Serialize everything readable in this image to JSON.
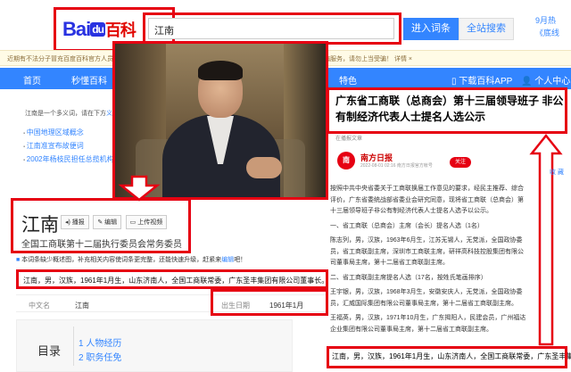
{
  "header": {
    "logo_brand": "Bai",
    "logo_du": "du",
    "logo_baike": "百科",
    "search_value": "江南",
    "enter_button": "进入词条",
    "search_button": "全站搜索",
    "top_right_1": "9月热",
    "top_right_2": "《底线"
  },
  "notice": "近期有不法分子冒充百度百科官方人员……",
  "notice_right": "不存在收费代编服务，请勿上当受骗！ 详情 ×",
  "nav": {
    "home": "首页",
    "miao": "秒懂百科",
    "tese": "特色",
    "app": "下载百科APP",
    "user": "个人中心"
  },
  "left": {
    "breadcrumb_prefix": "江南是一个多义词，请在下方",
    "breadcrumb_link": "义项",
    "links": [
      "中国地理区域概念",
      "江南准宣布故便词",
      "2002年杨枝民担任总揽机构"
    ],
    "title": "江南",
    "subtitle": "全国工商联第十二届执行委员会常务委员",
    "btn_play": "播报",
    "btn_edit": "编辑",
    "btn_video": "上传视频",
    "info_note_prefix": "本词条缺少概述图，补充相关内容使词条更完整，还能快速升级，赶紧来",
    "info_note_link": "编辑",
    "info_note_suffix": "吧！",
    "summary": "江南，男，汉族，1961年1月生，山东济南人，全国工商联常委，广东圣丰集团有限公司董事长。",
    "basic_key_1": "中文名",
    "basic_val_1": "江南",
    "basic_key_2": "出生日期",
    "basic_val_2": "1961年1月",
    "toc_title": "目录",
    "toc_items": [
      "1  人物经历",
      "2  职务任免"
    ]
  },
  "article": {
    "title": "广东省工商联（总商会）第十三届领导班子 非公有制经济代表人士提名人选公示",
    "source_label": "在播报文章",
    "publisher": "南方日报",
    "publisher_short": "南",
    "meta": "2022-08-01 02:16  南方日报官方帐号",
    "follow": "关注",
    "paragraphs": [
      "按照中共中央省委关于工商联换届工作意见的要求，经民主推荐、综合评价，广东省委统战部省委业会研究同意，现将省工商联（总商会）第十三届领导班子非公有制经济代表人士提名人选予以公示。",
      "一、省工商联（总商会）主席（会长）提名人选（1名）",
      "陈志列，男，汉族，1963年6月生，江苏无锡人，无党派，全国政协委员，省工商联副主席，深圳市工商联主席，研祥高科技控股集团有限公司董事局主席，第十二届省工商联副主席。",
      "二、省工商联副主席提名人选（17名，按姓氏笔画排序）",
      "王宇银，男，汉族，1968年3月生，安徽安庆人，无党派，全国政协委员，汇威国际集团有限公司董事局主席，第十二届省工商联副主席。",
      "王福英，男，汉族，1971年10月生，广东揭阳人，民建会员，广州福达企业集团有限公司董事局主席，第十二届省工商联副主席。"
    ],
    "bottom_text": "江南，男，汉族，1961年1月生，山东济南人，全国工商联常委，广东圣丰集团有",
    "side_float": "收 藏"
  }
}
